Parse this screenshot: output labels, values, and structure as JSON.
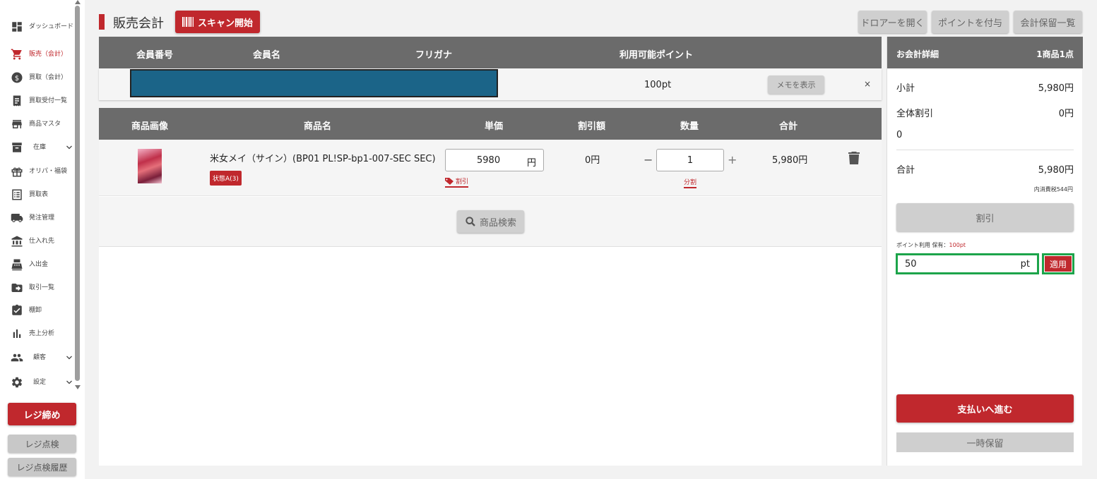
{
  "sidebar": {
    "items": [
      {
        "label": "ダッシュボード",
        "icon": "dashboard-icon"
      },
      {
        "label": "販売（会計）",
        "icon": "cart-icon",
        "active": true
      },
      {
        "label": "買取（会計）",
        "icon": "dollar-icon"
      },
      {
        "label": "買取受付一覧",
        "icon": "receipt-icon"
      },
      {
        "label": "商品マスタ",
        "icon": "store-icon"
      },
      {
        "label": "在庫",
        "icon": "archive-icon",
        "expandable": true
      },
      {
        "label": "オリパ・福袋",
        "icon": "gift-icon"
      },
      {
        "label": "買取表",
        "icon": "list-icon"
      },
      {
        "label": "発注管理",
        "icon": "truck-icon"
      },
      {
        "label": "仕入れ先",
        "icon": "bank-icon"
      },
      {
        "label": "入出金",
        "icon": "register-icon"
      },
      {
        "label": "取引一覧",
        "icon": "folder-arrow-icon"
      },
      {
        "label": "棚卸",
        "icon": "clipboard-check-icon"
      },
      {
        "label": "売上分析",
        "icon": "bar-chart-icon"
      },
      {
        "label": "顧客",
        "icon": "people-icon",
        "expandable": true
      },
      {
        "label": "設定",
        "icon": "gear-icon",
        "expandable": true
      }
    ],
    "close_register": "レジ締め",
    "register_check": "レジ点検",
    "register_check_history": "レジ点検履歴"
  },
  "header": {
    "title": "販売会計",
    "scan_button": "スキャン開始",
    "open_drawer": "ドロアーを開く",
    "grant_points": "ポイントを付与",
    "held_list": "会計保留一覧"
  },
  "member": {
    "columns": [
      "会員番号",
      "会員名",
      "フリガナ",
      "利用可能ポイント"
    ],
    "available_points": "100pt",
    "memo_button": "メモを表示",
    "close": "×"
  },
  "products": {
    "columns": [
      "商品画像",
      "商品名",
      "単価",
      "割引額",
      "数量",
      "合計"
    ],
    "rows": [
      {
        "name": "米女メイ（サイン）(BP01 PL!SP-bp1-007-SEC SEC)",
        "condition": "状態A(3)",
        "unit_price": "5980",
        "unit_price_suffix": "円",
        "discount_link": "割引",
        "discount_amount": "0円",
        "minus": "−",
        "quantity": "1",
        "plus": "+",
        "split_link": "分割",
        "total": "5,980円"
      }
    ],
    "search_button": "商品検索"
  },
  "detail": {
    "title": "お会計詳細",
    "item_count": "1商品1点",
    "subtotal_label": "小計",
    "subtotal_value": "5,980円",
    "overall_discount_label": "全体割引",
    "overall_discount_value": "0円",
    "discount_input": "0",
    "total_label": "合計",
    "total_value": "5,980円",
    "tax_note": "内消費税544円",
    "discount_button": "割引",
    "points_label": "ポイント利用 保有：",
    "points_held": "100pt",
    "points_input_value": "50",
    "points_unit": "pt",
    "apply_button": "適用",
    "pay_button": "支払いへ進む",
    "hold_button": "一時保留"
  },
  "colors": {
    "accent": "#c0282d",
    "header_gray": "#6b6b6b",
    "highlight_green": "#1ca44a",
    "member_blue": "#1b6488"
  }
}
